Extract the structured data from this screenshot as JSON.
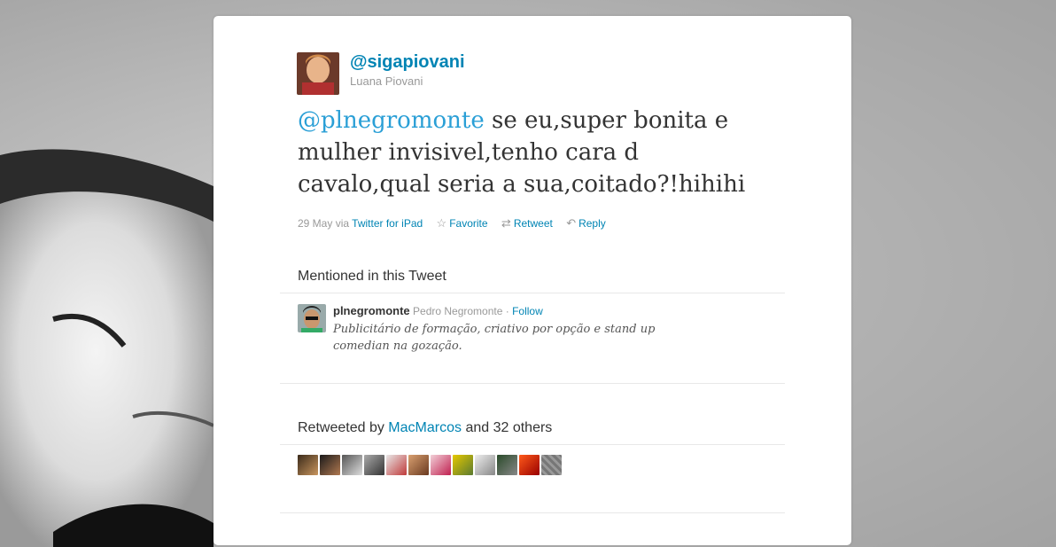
{
  "user": {
    "screen_name": "@sigapiovani",
    "full_name": "Luana Piovani"
  },
  "tweet": {
    "mention": "@plnegromonte",
    "text": " se eu,super bonita e mulher invisivel,tenho cara d cavalo,qual seria a sua,coitado?!hihihi"
  },
  "meta": {
    "date": "29 May",
    "via": "via",
    "client": "Twitter for iPad",
    "favorite": "Favorite",
    "retweet": "Retweet",
    "reply": "Reply"
  },
  "mentioned": {
    "title": "Mentioned in this Tweet",
    "screen_name": "plnegromonte",
    "full_name": "Pedro Negromonte",
    "separator": "·",
    "follow": "Follow",
    "bio": "Publicitário de formação, criativo por opção e stand up comedian na gozação."
  },
  "retweeted": {
    "prefix": "Retweeted by",
    "user": "MacMarcos",
    "suffix": "and 32 others",
    "faces": [
      "retweeter-1",
      "retweeter-2",
      "retweeter-3",
      "retweeter-4",
      "retweeter-5",
      "retweeter-6",
      "retweeter-7",
      "retweeter-8",
      "retweeter-9",
      "retweeter-10",
      "retweeter-11",
      "retweeter-12"
    ]
  },
  "colors": {
    "link": "#0084b4",
    "mention": "#2a9fd6",
    "text": "#333333",
    "muted": "#999999"
  },
  "icons": {
    "favorite": "star-icon",
    "retweet": "retweet-icon",
    "reply": "reply-icon"
  }
}
